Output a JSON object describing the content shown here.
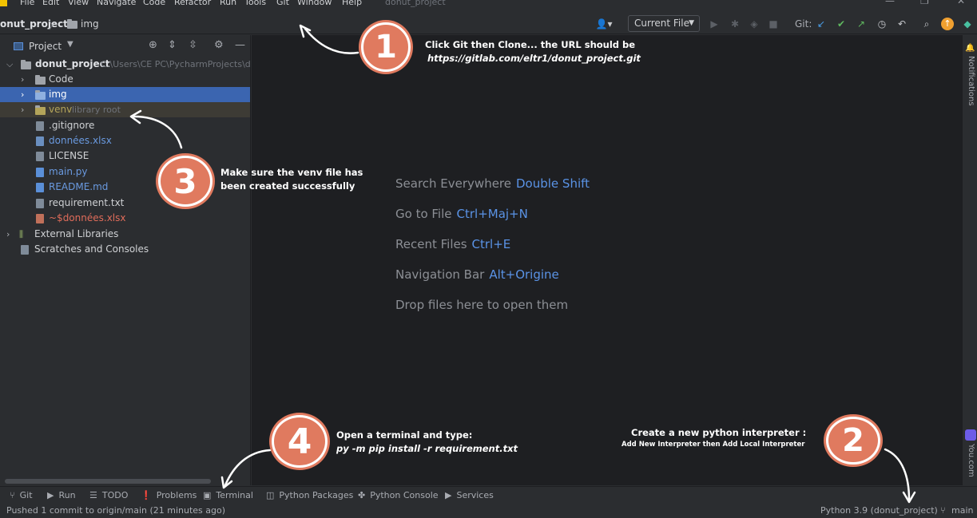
{
  "menu": {
    "items": [
      "File",
      "Edit",
      "View",
      "Navigate",
      "Code",
      "Refactor",
      "Run",
      "Tools",
      "Git",
      "Window",
      "Help"
    ],
    "window_title": "donut_project",
    "controls": [
      "—",
      "❐",
      "✕"
    ]
  },
  "navbar": {
    "breadcrumb_project": "onut_project",
    "breadcrumb_sep": "〉",
    "breadcrumb_folder": "img",
    "run_config": "Current File",
    "git_label": "Git:"
  },
  "project_panel": {
    "title": "Project",
    "tree": [
      {
        "label": "donut_project",
        "hint": "C:\\Users\\CE PC\\PycharmProjects\\don",
        "type": "folder-root"
      },
      {
        "label": "Code",
        "hint": "",
        "type": "folder"
      },
      {
        "label": "img",
        "hint": "",
        "type": "folder",
        "selected": true
      },
      {
        "label": "venv",
        "hint": "library root",
        "type": "folder-venv"
      },
      {
        "label": ".gitignore",
        "hint": "",
        "type": "file"
      },
      {
        "label": "données.xlsx",
        "hint": "",
        "type": "file-blue"
      },
      {
        "label": "LICENSE",
        "hint": "",
        "type": "file"
      },
      {
        "label": "main.py",
        "hint": "",
        "type": "file-blue"
      },
      {
        "label": "README.md",
        "hint": "",
        "type": "file-blue"
      },
      {
        "label": "requirement.txt",
        "hint": "",
        "type": "file"
      },
      {
        "label": "~$données.xlsx",
        "hint": "",
        "type": "file-red"
      },
      {
        "label": "External Libraries",
        "hint": "",
        "type": "lib"
      },
      {
        "label": "Scratches and Consoles",
        "hint": "",
        "type": "scratch"
      }
    ]
  },
  "editor": {
    "hints": [
      {
        "text": "Search Everywhere",
        "key": "Double Shift"
      },
      {
        "text": "Go to File",
        "key": "Ctrl+Maj+N"
      },
      {
        "text": "Recent Files",
        "key": "Ctrl+E"
      },
      {
        "text": "Navigation Bar",
        "key": "Alt+Origine"
      },
      {
        "text": "Drop files here to open them",
        "key": ""
      }
    ]
  },
  "right_strip": {
    "notifications": "Notifications",
    "youcom": "You.com"
  },
  "tool_windows": [
    "Git",
    "Run",
    "TODO",
    "Problems",
    "Terminal",
    "Python Packages",
    "Python Console",
    "Services"
  ],
  "status": {
    "left": "Pushed 1 commit to origin/main (21 minutes ago)",
    "interpreter": "Python 3.9 (donut_project)",
    "branch": "main"
  },
  "annotations": {
    "step1": {
      "num": "1",
      "line1": "Click Git then Clone... the URL should be",
      "line2": "https://gitlab.com/eltr1/donut_project.git"
    },
    "step2": {
      "num": "2",
      "line1": "Create a new python interpreter :",
      "line2": "Add New Interpreter then Add Local Interpreter"
    },
    "step3": {
      "num": "3",
      "line1": "Make sure the venv file has",
      "line2": "been created successfully"
    },
    "step4": {
      "num": "4",
      "line1": "Open a  terminal and type:",
      "line2": "py -m pip install -r requirement.txt"
    }
  },
  "colors": {
    "accent_blue": "#5a93e6",
    "badge": "#e07a5f",
    "selection": "#2e436e"
  }
}
